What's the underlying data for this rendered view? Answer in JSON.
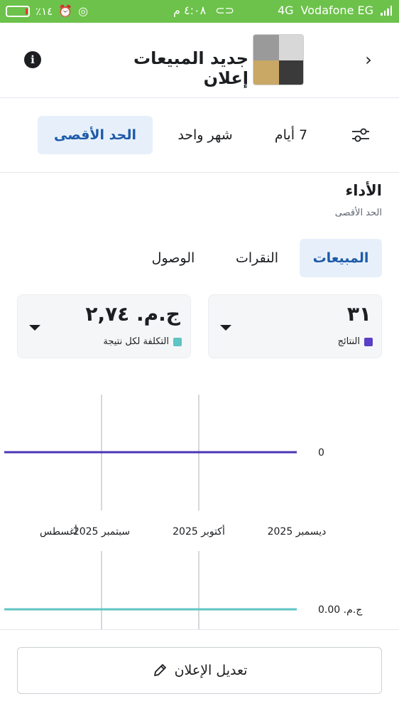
{
  "status_bar": {
    "battery_percent": "٪١٤",
    "time": "٤:٠٨ م",
    "network": "4G",
    "carrier": "Vodafone EG"
  },
  "header": {
    "title": "جديد المبيعات إعلان"
  },
  "date_filters": [
    {
      "label": "الحد الأقصى",
      "active": true
    },
    {
      "label": "شهر واحد",
      "active": false
    },
    {
      "label": "7 أيام",
      "active": false
    }
  ],
  "performance": {
    "title": "الأداء",
    "subtitle": "الحد الأقصى"
  },
  "metric_tabs": [
    {
      "label": "المبيعات",
      "active": true
    },
    {
      "label": "النقرات",
      "active": false
    },
    {
      "label": "الوصول",
      "active": false
    }
  ],
  "cards": {
    "results": {
      "value": "٣١",
      "label": "النتائج",
      "color": "#5b3fc4"
    },
    "cost": {
      "value": "ج.م. ٢,٧٤",
      "label": "التكلفة لكل نتيجة",
      "color": "#5ec4c4"
    }
  },
  "chart_data": [
    {
      "type": "line",
      "x": [
        "أغسطس",
        "سبتمبر 2025",
        "أكتوبر 2025",
        "ديسمبر 2025"
      ],
      "series": [
        {
          "values": [
            0,
            0,
            0,
            0
          ],
          "color": "#4c35b5"
        }
      ],
      "ytick_label": "0"
    },
    {
      "type": "line",
      "x": [
        "أغسطس",
        "سبتمبر 2025",
        "أكتوبر 2025",
        "ديسمبر 2025"
      ],
      "series": [
        {
          "values": [
            0,
            0,
            0,
            0
          ],
          "color": "#5ec4c4"
        }
      ],
      "ytick_label": "ج.م. 0.00"
    }
  ],
  "edit_button": {
    "label": "تعديل الإعلان"
  }
}
